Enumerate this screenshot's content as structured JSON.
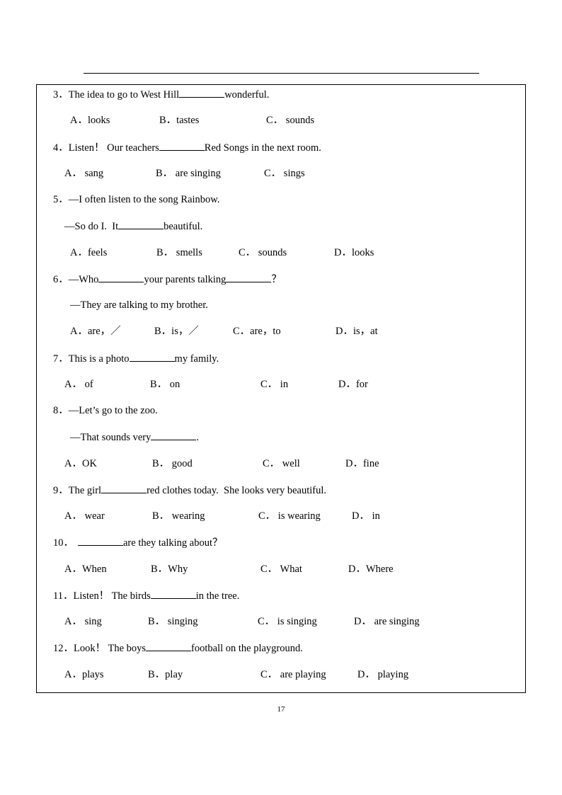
{
  "page_number": "17",
  "questions": [
    {
      "num": "3．",
      "parts": [
        "The idea to go to West Hill",
        "wonderful."
      ],
      "options": [
        "A．looks",
        "B．tastes",
        "C． sounds"
      ]
    },
    {
      "num": "4．",
      "parts": [
        "Listen！ Our teachers",
        "Red Songs in the next room."
      ],
      "options": [
        "A． sang",
        "B． are singing",
        "C． sings"
      ]
    },
    {
      "num": "5．",
      "line1": "—I often listen to the song Rainbow.",
      "parts": [
        "—So do I.  It",
        "beautiful."
      ],
      "options": [
        "A．feels",
        "B． smells",
        "C． sounds",
        "D．looks"
      ]
    },
    {
      "num": "6．",
      "parts": [
        "—Who",
        "your parents talking",
        "？"
      ],
      "line2": "—They are talking to my brother.",
      "options": [
        "A．are，／",
        "B．is，／",
        "C．are，to",
        "D．is，at"
      ]
    },
    {
      "num": "7．",
      "parts": [
        "This is a photo",
        "my family."
      ],
      "options": [
        "A． of",
        "B． on",
        "C． in",
        "D．for"
      ]
    },
    {
      "num": "8．",
      "line1": "—Let’s go to the zoo.",
      "parts": [
        "—That sounds very",
        "."
      ],
      "options": [
        "A．OK",
        "B． good",
        "C． well",
        "D．fine"
      ]
    },
    {
      "num": "9．",
      "parts": [
        "The girl",
        "red clothes today.  She looks very beautiful."
      ],
      "options": [
        "A． wear",
        "B． wearing",
        "C． is wearing",
        "D． in"
      ]
    },
    {
      "num": "10．",
      "parts": [
        "",
        "are they talking about？"
      ],
      "options": [
        "A．When",
        "B．Why",
        "C． What",
        "D．Where"
      ]
    },
    {
      "num": "11．",
      "parts": [
        "Listen！ The birds",
        "in the tree."
      ],
      "options": [
        "A． sing",
        "B． singing",
        "C． is singing",
        "D． are singing"
      ]
    },
    {
      "num": "12．",
      "parts": [
        "Look！ The boys",
        "football on the playground."
      ],
      "options": [
        "A．plays",
        "B．play",
        "C． are playing",
        "D． playing"
      ]
    }
  ]
}
